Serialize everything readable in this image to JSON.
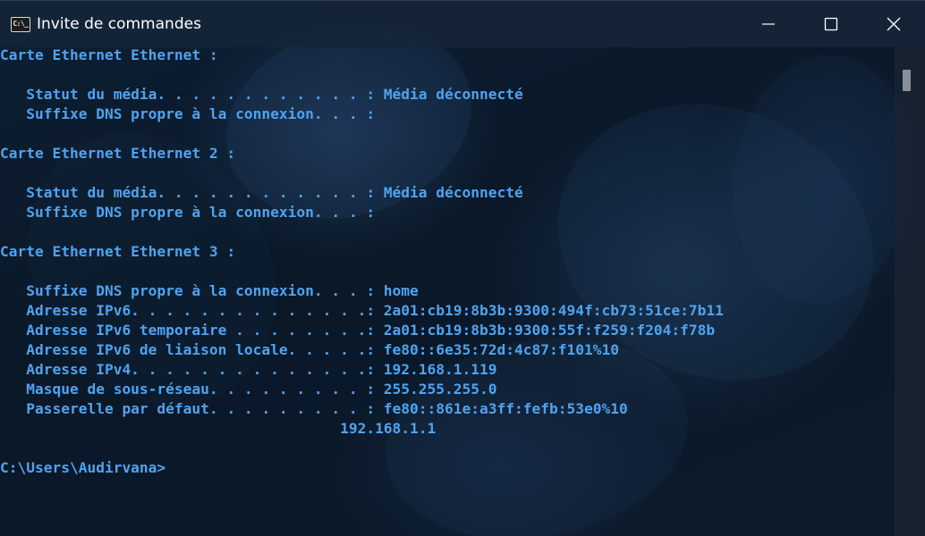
{
  "window": {
    "title": "Invite de commandes",
    "icon": "cmd-icon",
    "icon_glyph": "C:\\_"
  },
  "controls": {
    "minimize": "minimize-icon",
    "maximize": "maximize-icon",
    "close": "close-icon"
  },
  "console": {
    "lines": [
      "Carte Ethernet Ethernet :",
      "",
      "   Statut du média. . . . . . . . . . . . : Média déconnecté",
      "   Suffixe DNS propre à la connexion. . . :",
      "",
      "Carte Ethernet Ethernet 2 :",
      "",
      "   Statut du média. . . . . . . . . . . . : Média déconnecté",
      "   Suffixe DNS propre à la connexion. . . :",
      "",
      "Carte Ethernet Ethernet 3 :",
      "",
      "   Suffixe DNS propre à la connexion. . . : home",
      "   Adresse IPv6. . . . . . . . . . . . . .: 2a01:cb19:8b3b:9300:494f:cb73:51ce:7b11",
      "   Adresse IPv6 temporaire . . . . . . . .: 2a01:cb19:8b3b:9300:55f:f259:f204:f78b",
      "   Adresse IPv6 de liaison locale. . . . .: fe80::6e35:72d:4c87:f101%10",
      "   Adresse IPv4. . . . . . . . . . . . . .: 192.168.1.119",
      "   Masque de sous-réseau. . . . . . . . . : 255.255.255.0",
      "   Passerelle par défaut. . . . . . . . . : fe80::861e:a3ff:fefb:53e0%10",
      "                                       192.168.1.1",
      "",
      "C:\\Users\\Audirvana>"
    ]
  },
  "colors": {
    "console_text": "#4fa3f0",
    "titlebar_bg": "#162638",
    "background": "#0b1a2b"
  }
}
